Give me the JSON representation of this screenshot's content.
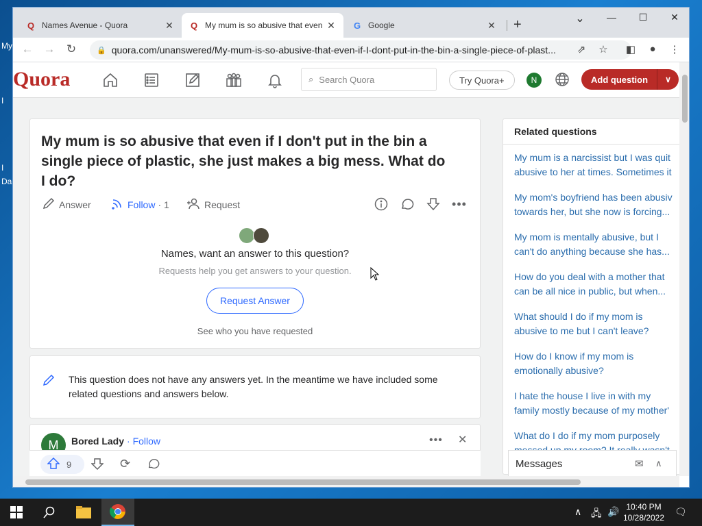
{
  "desktop": {
    "labels": [
      "My",
      "I",
      "I",
      "Da"
    ]
  },
  "browser": {
    "tabs": [
      {
        "favicon": "Q",
        "title": "Names Avenue - Quora",
        "active": false
      },
      {
        "favicon": "Q",
        "title": "My mum is so abusive that even",
        "active": true
      },
      {
        "favicon": "G",
        "title": "Google",
        "active": false
      }
    ],
    "url": "quora.com/unanswered/My-mum-is-so-abusive-that-even-if-I-dont-put-in-the-bin-a-single-piece-of-plast...",
    "new_tab": "+",
    "win_min": "—",
    "win_max": "☐",
    "win_close": "✕",
    "chevron": "⌄"
  },
  "quora": {
    "logo": "Quora",
    "search_placeholder": "Search Quora",
    "try_plus": "Try Quora+",
    "avatar_initial": "N",
    "add_question": "Add question",
    "question": {
      "title": "My mum is so abusive that even if I don't put in the bin a single piece of plastic, she just makes a big mess. What do I do?",
      "answer_label": "Answer",
      "follow_label": "Follow",
      "follow_count": "· 1",
      "request_label": "Request"
    },
    "request_box": {
      "title": "Names, want an answer to this question?",
      "subtitle": "Requests help you get answers to your question.",
      "button": "Request Answer",
      "link": "See who you have requested"
    },
    "no_answers_text": "This question does not have any answers yet. In the meantime we have included some related questions and answers below.",
    "answer_preview": {
      "author": "Bored Lady",
      "follow": "· Follow",
      "avatar_initial": "M",
      "upvotes": "9"
    },
    "related": {
      "heading": "Related questions",
      "items": [
        "My mum is a narcissist but I was quit",
        "abusive to her at times. Sometimes it",
        "My mom's boyfriend has been abusiv",
        "towards her, but she now is forcing...",
        "My mom is mentally abusive, but I",
        "can't do anything because she has...",
        "How do you deal with a mother that",
        "can be all nice in public, but when...",
        "What should I do if my mom is",
        "abusive to me but I can't leave?",
        "How do I know if my mom is",
        "emotionally abusive?",
        "I hate the house I live in with my",
        "family mostly because of my mother'",
        "What do I do if my mom purposely",
        "messed up my room? It really wasn't"
      ]
    },
    "messages_label": "Messages"
  },
  "taskbar": {
    "time": "10:40 PM",
    "date": "10/28/2022"
  },
  "colors": {
    "quora_red": "#b92b27",
    "link_blue": "#2b6dad",
    "follow_blue": "#2e69ff"
  }
}
